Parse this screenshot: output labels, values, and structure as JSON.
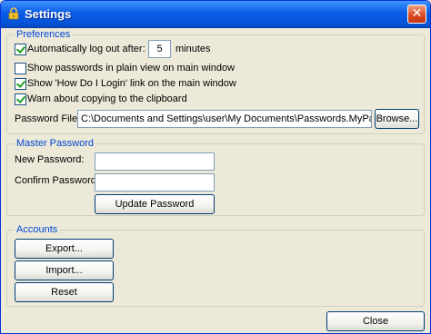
{
  "window": {
    "title": "Settings",
    "close_glyph": "✕"
  },
  "preferences": {
    "legend": "Preferences",
    "auto_logout": {
      "checked": true,
      "label": "Automatically log out after:",
      "minutes_value": "5",
      "minutes_suffix": "minutes"
    },
    "options": [
      {
        "label": "Show passwords in plain view on main window",
        "checked": false
      },
      {
        "label": "Show 'How Do I Login' link on the main window",
        "checked": true
      },
      {
        "label": "Warn about copying to the clipboard",
        "checked": true
      }
    ],
    "password_file": {
      "label": "Password File:",
      "value": "C:\\Documents and Settings\\user\\My Documents\\Passwords.MyPadlock",
      "browse_label": "Browse..."
    }
  },
  "master_password": {
    "legend": "Master Password",
    "new_label": "New Password:",
    "new_value": "",
    "confirm_label": "Confirm Password:",
    "confirm_value": "",
    "update_label": "Update Password"
  },
  "accounts": {
    "legend": "Accounts",
    "export_label": "Export...",
    "import_label": "Import...",
    "reset_label": "Reset"
  },
  "footer": {
    "close_label": "Close"
  },
  "icons": {
    "title": "padlock-icon",
    "checkmark": "checkmark-icon"
  },
  "colors": {
    "title_bar": "#0a5ce6",
    "legend_text": "#0046d5",
    "window_bg": "#ece9d8",
    "close_button": "#d9461d"
  }
}
